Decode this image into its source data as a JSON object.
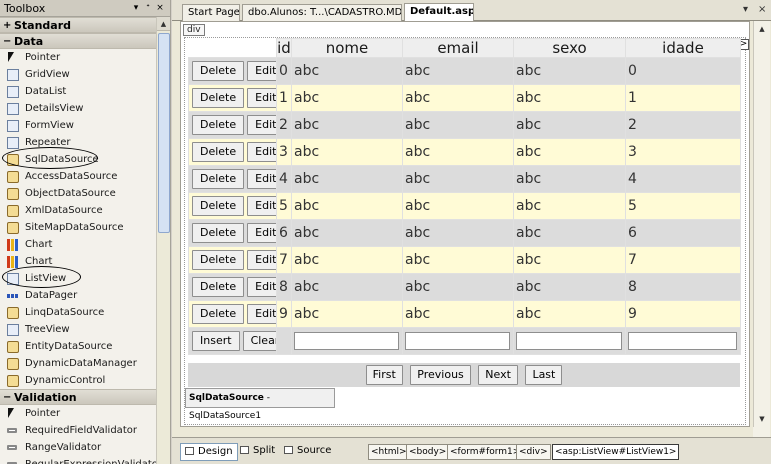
{
  "toolbox": {
    "title": "Toolbox",
    "pin_symbol": "▾",
    "autohide_symbol": "ᐩ",
    "close_symbol": "×",
    "sections": [
      {
        "name": "Standard",
        "expanded": false,
        "items": []
      },
      {
        "name": "Data",
        "expanded": true,
        "items": [
          {
            "label": "Pointer",
            "icon": "pointer-icon"
          },
          {
            "label": "GridView",
            "icon": "gridview-icon"
          },
          {
            "label": "DataList",
            "icon": "datalist-icon"
          },
          {
            "label": "DetailsView",
            "icon": "detailsview-icon"
          },
          {
            "label": "FormView",
            "icon": "formview-icon"
          },
          {
            "label": "Repeater",
            "icon": "repeater-icon"
          },
          {
            "label": "SqlDataSource",
            "icon": "sqldatasource-icon"
          },
          {
            "label": "AccessDataSource",
            "icon": "accessdatasource-icon"
          },
          {
            "label": "ObjectDataSource",
            "icon": "objectdatasource-icon"
          },
          {
            "label": "XmlDataSource",
            "icon": "xmldatasource-icon"
          },
          {
            "label": "SiteMapDataSource",
            "icon": "sitemapdatasource-icon"
          },
          {
            "label": "Chart",
            "icon": "chart-icon"
          },
          {
            "label": "Chart",
            "icon": "chart-icon"
          },
          {
            "label": "ListView",
            "icon": "listview-icon"
          },
          {
            "label": "DataPager",
            "icon": "datapager-icon"
          },
          {
            "label": "LinqDataSource",
            "icon": "linqdatasource-icon"
          },
          {
            "label": "TreeView",
            "icon": "treeview-icon"
          },
          {
            "label": "EntityDataSource",
            "icon": "entitydatasource-icon"
          },
          {
            "label": "DynamicDataManager",
            "icon": "dynamicdatamanager-icon"
          },
          {
            "label": "DynamicControl",
            "icon": "dynamiccontrol-icon"
          }
        ]
      },
      {
        "name": "Validation",
        "expanded": true,
        "items": [
          {
            "label": "Pointer",
            "icon": "pointer-icon"
          },
          {
            "label": "RequiredFieldValidator",
            "icon": "validator-icon"
          },
          {
            "label": "RangeValidator",
            "icon": "validator-icon"
          },
          {
            "label": "RegularExpressionValidator",
            "icon": "validator-icon"
          }
        ]
      }
    ]
  },
  "tabs": [
    {
      "label": "Start Page",
      "active": false
    },
    {
      "label": "dbo.Alunos: T...\\CADASTRO.MDF)",
      "active": false
    },
    {
      "label": "Default.aspx",
      "active": true
    }
  ],
  "tab_controls": {
    "dropdown": "▾",
    "close": "×"
  },
  "design": {
    "div_tag": "div",
    "smart_tag": ">",
    "listview": {
      "columns": [
        "id",
        "nome",
        "email",
        "sexo",
        "idade"
      ],
      "delete_label": "Delete",
      "edit_label": "Edit",
      "rows": [
        {
          "id": "0",
          "nome": "abc",
          "email": "abc",
          "sexo": "abc",
          "idade": "0"
        },
        {
          "id": "1",
          "nome": "abc",
          "email": "abc",
          "sexo": "abc",
          "idade": "1"
        },
        {
          "id": "2",
          "nome": "abc",
          "email": "abc",
          "sexo": "abc",
          "idade": "2"
        },
        {
          "id": "3",
          "nome": "abc",
          "email": "abc",
          "sexo": "abc",
          "idade": "3"
        },
        {
          "id": "4",
          "nome": "abc",
          "email": "abc",
          "sexo": "abc",
          "idade": "4"
        },
        {
          "id": "5",
          "nome": "abc",
          "email": "abc",
          "sexo": "abc",
          "idade": "5"
        },
        {
          "id": "6",
          "nome": "abc",
          "email": "abc",
          "sexo": "abc",
          "idade": "6"
        },
        {
          "id": "7",
          "nome": "abc",
          "email": "abc",
          "sexo": "abc",
          "idade": "7"
        },
        {
          "id": "8",
          "nome": "abc",
          "email": "abc",
          "sexo": "abc",
          "idade": "8"
        },
        {
          "id": "9",
          "nome": "abc",
          "email": "abc",
          "sexo": "abc",
          "idade": "9"
        }
      ],
      "insert_label": "Insert",
      "clear_label": "Clear"
    },
    "pager": {
      "first": "First",
      "previous": "Previous",
      "next": "Next",
      "last": "Last"
    },
    "datasource": {
      "type": "SqlDataSource",
      "separator": " - ",
      "name": "SqlDataSource1"
    }
  },
  "bottom_bar": {
    "views": [
      {
        "label": "Design",
        "active": true
      },
      {
        "label": "Split",
        "active": false
      },
      {
        "label": "Source",
        "active": false
      }
    ],
    "breadcrumbs": [
      "<html>",
      "<body>",
      "<form#form1>",
      "<div>",
      "<asp:ListView#ListView1>"
    ]
  }
}
